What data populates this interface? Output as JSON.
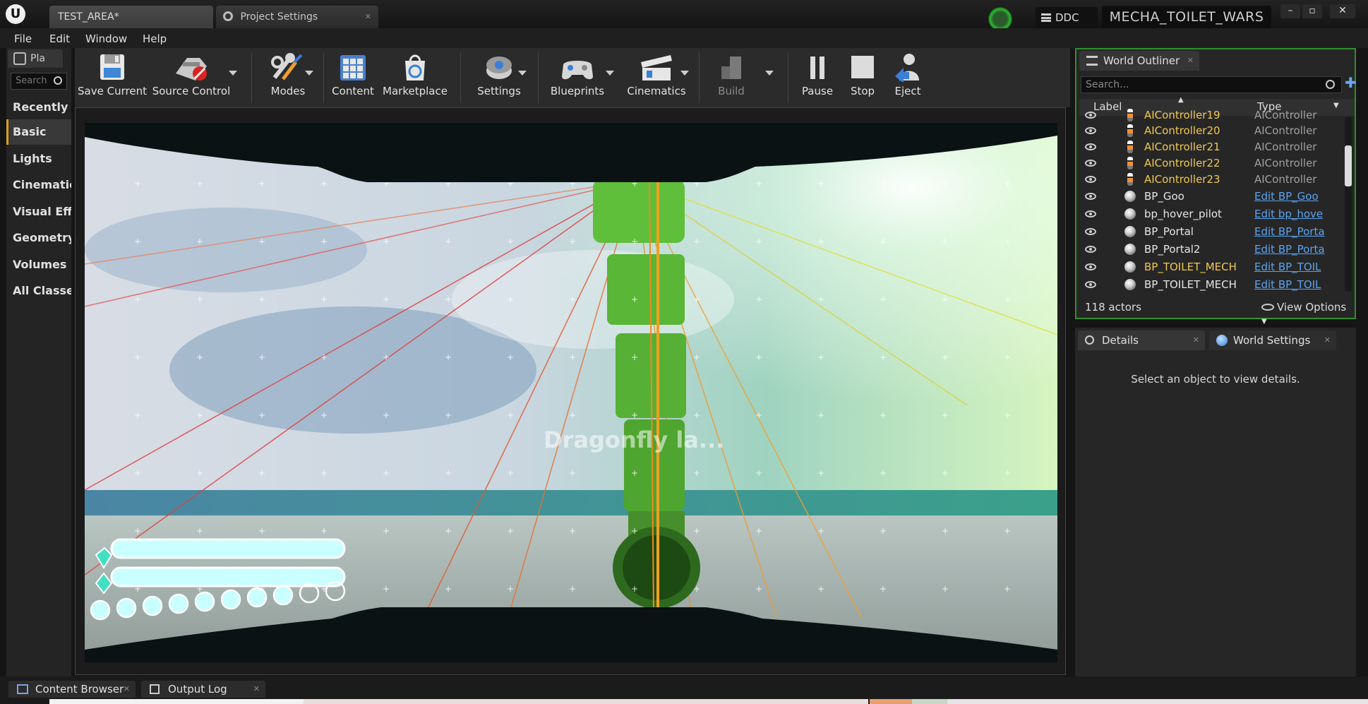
{
  "titlebar": {
    "logo_text": "U",
    "tabs": [
      {
        "label": "TEST_AREA*"
      },
      {
        "label": "Project Settings"
      }
    ],
    "ddc_label": "DDC",
    "project_name": "MECHA_TOILET_WARS",
    "window_buttons": [
      "–",
      "▫",
      "✕"
    ]
  },
  "menu": [
    "File",
    "Edit",
    "Window",
    "Help"
  ],
  "place_panel": {
    "tab_label": "Pla",
    "search_placeholder": "Search",
    "items": [
      "Recently Placed",
      "Basic",
      "Lights",
      "Cinematic",
      "Visual Effects",
      "Geometry",
      "Volumes",
      "All Classes"
    ],
    "active_index": 1
  },
  "toolbar": {
    "buttons": [
      {
        "label": "Save Current",
        "icon": "save-icon"
      },
      {
        "label": "Source Control",
        "icon": "source-control-icon"
      },
      {
        "label": "Modes",
        "icon": "modes-icon"
      },
      {
        "label": "Content",
        "icon": "content-icon"
      },
      {
        "label": "Marketplace",
        "icon": "marketplace-icon"
      },
      {
        "label": "Settings",
        "icon": "settings-icon"
      },
      {
        "label": "Blueprints",
        "icon": "blueprints-icon"
      },
      {
        "label": "Cinematics",
        "icon": "cinematics-icon"
      },
      {
        "label": "Build",
        "icon": "build-icon"
      },
      {
        "label": "Pause",
        "icon": "pause-icon"
      },
      {
        "label": "Stop",
        "icon": "stop-icon"
      },
      {
        "label": "Eject",
        "icon": "eject-icon"
      }
    ]
  },
  "viewport": {
    "overlay_text": "Dragonfly la..."
  },
  "outliner": {
    "tab_label": "World Outliner",
    "search_placeholder": "Search...",
    "col_label": "Label",
    "col_type": "Type",
    "rows": [
      {
        "label": "AIController19",
        "type": "AIController",
        "color": "gold",
        "link": false
      },
      {
        "label": "AIController20",
        "type": "AIController",
        "color": "gold",
        "link": false
      },
      {
        "label": "AIController21",
        "type": "AIController",
        "color": "gold",
        "link": false
      },
      {
        "label": "AIController22",
        "type": "AIController",
        "color": "gold",
        "link": false
      },
      {
        "label": "AIController23",
        "type": "AIController",
        "color": "gold",
        "link": false
      },
      {
        "label": "BP_Goo",
        "type": "Edit BP_Goo",
        "color": "white",
        "link": true
      },
      {
        "label": "bp_hover_pilot",
        "type": "Edit bp_hove",
        "color": "white",
        "link": true
      },
      {
        "label": "BP_Portal",
        "type": "Edit BP_Porta",
        "color": "white",
        "link": true
      },
      {
        "label": "BP_Portal2",
        "type": "Edit BP_Porta",
        "color": "white",
        "link": true
      },
      {
        "label": "BP_TOILET_MECH",
        "type": "Edit BP_TOIL",
        "color": "gold",
        "link": true
      },
      {
        "label": "BP_TOILET_MECH",
        "type": "Edit BP_TOIL",
        "color": "white",
        "link": true
      }
    ],
    "actor_count": "118 actors",
    "view_options": "View Options"
  },
  "details": {
    "tab_details": "Details",
    "tab_world_settings": "World Settings",
    "empty_message": "Select an object to view details."
  },
  "bottom": {
    "tabs": [
      "Content Browser",
      "Output Log"
    ]
  }
}
